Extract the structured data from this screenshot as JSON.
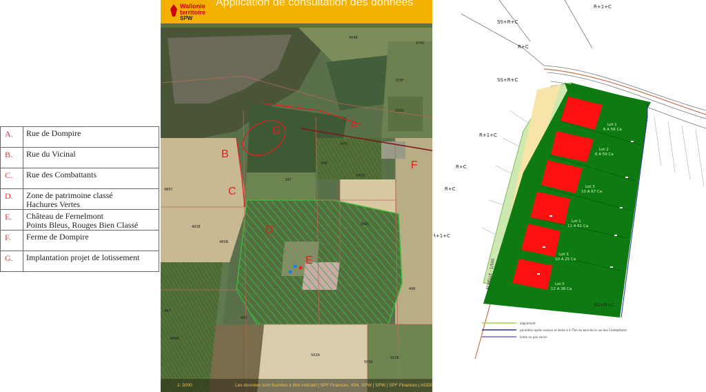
{
  "header": {
    "logo_line1": "Wallonie",
    "logo_line2": "territoire",
    "logo_line3": "SPW",
    "title": "Application de consultation des données"
  },
  "legend": [
    {
      "code": "A.",
      "label": "Rue de Dompire"
    },
    {
      "code": "B.",
      "label": "Rue du Vicinal"
    },
    {
      "code": "C.",
      "label": "Rue des Combattants"
    },
    {
      "code": "D.",
      "label": "Zone de patrimoine classé",
      "label2": "Hachures Vertes"
    },
    {
      "code": "E.",
      "label": "Château de Fernelmont",
      "label2": "Points Bleus, Rouges Bien Classé"
    },
    {
      "code": "F.",
      "label": "Ferme de Dompire"
    },
    {
      "code": "G.",
      "label": "Implantation projet de lotissement"
    }
  ],
  "map_letters": {
    "A": "A",
    "B": "B",
    "C": "C",
    "D": "D",
    "E": "E",
    "F": "F",
    "G": "G"
  },
  "parcels": [
    "404E",
    "374C",
    "333F",
    "335D",
    "343I",
    "345D",
    "342C",
    "347",
    "348",
    "485Y",
    "483E",
    "485B",
    "492",
    "497",
    "502A",
    "503A",
    "503E",
    "494A",
    "496"
  ],
  "footer": {
    "scale": "1: 5000",
    "note": "Les données sont fournies à titre indicatif | SPF Finances, IGN, SPW | SPW | SPF Finances | AGDP"
  },
  "plan": {
    "zones": [
      "R+1+C",
      "SS+R+C",
      "R+C",
      "SS+R+C",
      "R+1+C",
      "R+C",
      "R+C",
      "R+1+C",
      "SS+R+C"
    ],
    "lots": [
      {
        "name": "Lot 1",
        "area": "6 A 56 Ca"
      },
      {
        "name": "Lot 2",
        "area": "6 A 59 Ca"
      },
      {
        "name": "Lot 3",
        "area": "10 A 67 Ca"
      },
      {
        "name": "Lot 1",
        "area": "11 A 61 Ca"
      },
      {
        "name": "Lot 3",
        "area": "10 A 25 Ca"
      },
      {
        "name": "Lot 5",
        "area": "12 A 38 Ca"
      }
    ],
    "echelle": "ECHELLE : 1/500",
    "legend_lines": [
      {
        "label": "alignement",
        "color": "#9fd34a"
      },
      {
        "label": "périmètre après cession et limite à 4,75m du bord de la rue des Combattants",
        "color": "#2b2f9e"
      },
      {
        "label": "limite en pan serrer",
        "color": "#7a5ad0"
      }
    ]
  },
  "colors": {
    "header": "#f4b000",
    "letters": "#e02020",
    "hatch": "#3fb43f",
    "lot_green": "#0d7a12",
    "lot_red": "#ff1010"
  }
}
